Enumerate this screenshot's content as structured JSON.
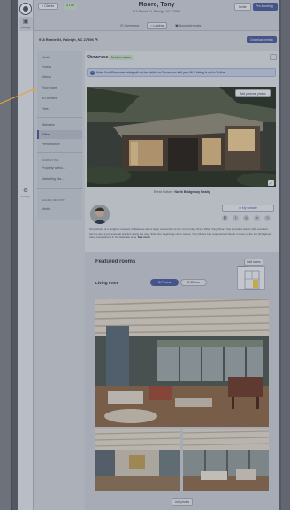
{
  "app": {
    "rail": [
      {
        "icon": "client-icon",
        "label": "Listings"
      },
      {
        "icon": "gear-icon",
        "label": "Settings"
      }
    ]
  },
  "header": {
    "back_label": "‹ Clients",
    "live_badge": "● Live",
    "client_name": "Moore, Tony",
    "client_address": "918 Ramie St, Raleigh, NC 27896",
    "invite_label": "Invite",
    "prebooking_label": "Pre-Booking ⌄",
    "tabs": [
      {
        "label": "Overview",
        "icon": "◎"
      },
      {
        "label": "Listing",
        "icon": "⌂"
      },
      {
        "label": "Appointments",
        "icon": "▣"
      }
    ]
  },
  "listing": {
    "address": "918 Ramie St, Raleigh, NC 27896",
    "download_label": "Download media"
  },
  "leftnav": {
    "groups": [
      {
        "items": [
          "Media",
          "Photos",
          "Videos",
          "Floor plans",
          "3D content",
          "Files"
        ]
      },
      {
        "items": [
          "Websites",
          "Editor",
          "Performance"
        ]
      },
      {
        "heading": "MARKETING",
        "items": [
          "Property websi...",
          "Marketing kits..."
        ]
      },
      {
        "heading": "SHARE REPORT",
        "items": [
          "Media"
        ]
      }
    ],
    "active": "Editor"
  },
  "showcase": {
    "title": "Showcase",
    "badge": "Ready to review",
    "info_text": "Note: Your Showcase listing will not be visible on Showcase until your MLS listing is set to 'Active'.",
    "personal_photo_label": "Add personal photos",
    "agent_name": "Brent Sutton",
    "agent_company": "North Bridgeway Realty",
    "my_website_label": "⊕ My website",
    "social_icons": [
      "⛓",
      "f",
      "◎",
      "in",
      "𝕏"
    ],
    "bio": "Tony Moore is a longtime resident of Bellevue with a deep connection to her community. Since 2002, Tony Moore has provided clients with excellent service and a professional practice along the way. Since the beginning of her career, Tony Moore has represented clients in three of the top 20 highest value transactions in the Eastside area.",
    "see_more": "See more"
  },
  "featured": {
    "title": "Featured rooms",
    "edit_label": "Edit rooms",
    "room": "Living room",
    "photos_label": "⊞ Photos",
    "tour_label": "⊡ 3D tour",
    "floor_label": "FLOOR 1",
    "add_photos_label": "Add photos"
  },
  "colors": {
    "brand": "#4e5f9c",
    "live": "#35713f",
    "surface": "#d6d9e0"
  }
}
